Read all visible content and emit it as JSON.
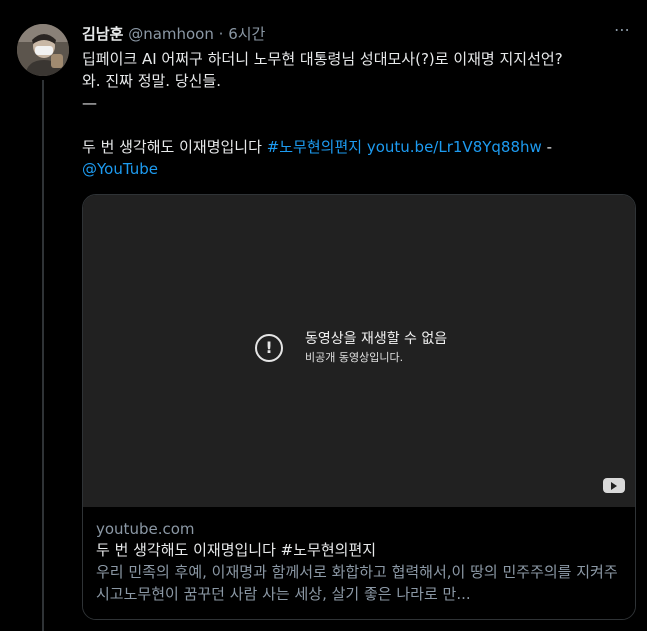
{
  "tweet": {
    "name": "김남훈",
    "handle": "@namhoon",
    "dot": "·",
    "time": "6시간",
    "more_icon": "⋯",
    "line1": "딥페이크 AI 어쩌구 하더니 노무현 대통령님 성대모사(?)로 이재명 지지선언?",
    "line2": "와. 진짜 정말. 당신들.",
    "line3": "—",
    "line4_text": "두 번 생각해도 이재명입니다 ",
    "hashtag": "#노무현의편지",
    "url": "youtu.be/Lr1V8Yq88hw",
    "dash": " -",
    "mention": "@YouTube"
  },
  "card": {
    "video_error_title": "동영상을 재생할 수 없음",
    "video_error_sub": "비공개 동영상입니다.",
    "error_icon": "!",
    "domain": "youtube.com",
    "title": "두 번 생각해도 이재명입니다 #노무현의편지",
    "description": "우리 민족의 후예, 이재명과 함께서로 화합하고 협력해서,이 땅의 민주주의를 지켜주시고노무현이 꿈꾸던 사람 사는 세상, 살기 좋은 나라로 만..."
  },
  "colors": {
    "background": "#000000",
    "link": "#1d9bf0",
    "secondary_text": "#8b98a5",
    "video_bg": "#212121"
  }
}
